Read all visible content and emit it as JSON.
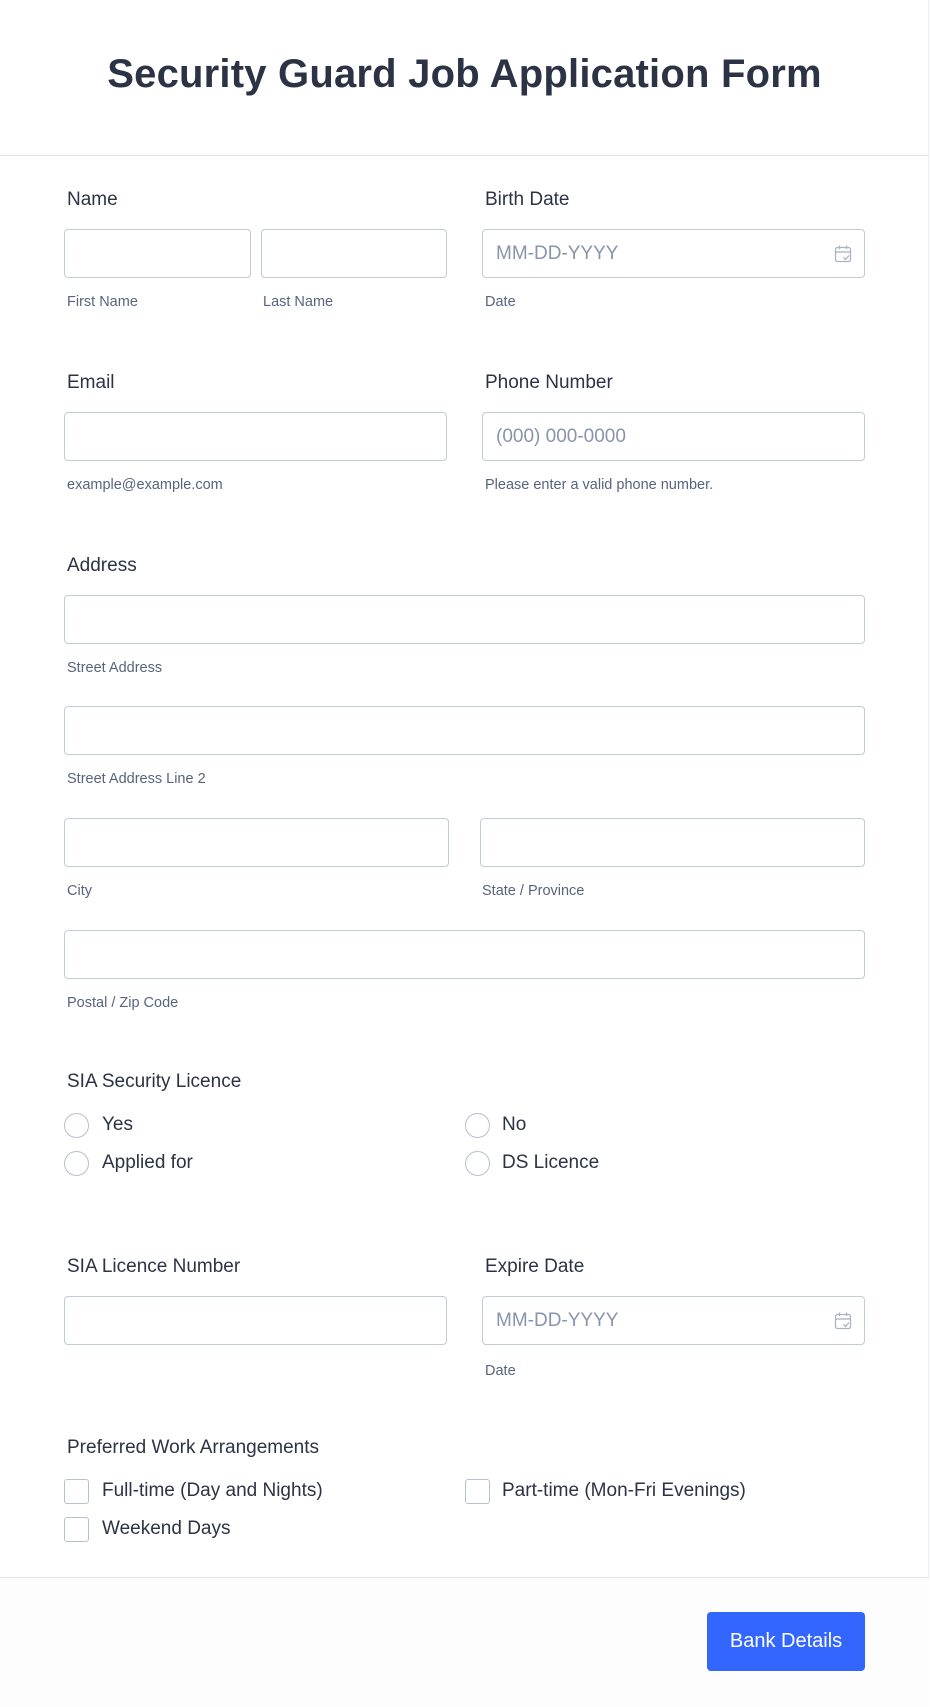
{
  "header": {
    "title": "Security Guard Job Application Form"
  },
  "fields": {
    "name": {
      "label": "Name",
      "first_sublabel": "First Name",
      "last_sublabel": "Last Name",
      "first_value": "",
      "last_value": ""
    },
    "birth_date": {
      "label": "Birth Date",
      "placeholder": "MM-DD-YYYY",
      "sublabel": "Date",
      "icon": "calendar-icon"
    },
    "email": {
      "label": "Email",
      "value": "",
      "sublabel": "example@example.com"
    },
    "phone": {
      "label": "Phone Number",
      "placeholder": "(000) 000-0000",
      "sublabel": "Please enter a valid phone number."
    },
    "address": {
      "label": "Address",
      "street_sublabel": "Street Address",
      "street2_sublabel": "Street Address Line 2",
      "city_sublabel": "City",
      "state_sublabel": "State / Province",
      "postal_sublabel": "Postal / Zip Code"
    },
    "sia_licence": {
      "label": "SIA Security Licence",
      "options": [
        "Yes",
        "No",
        "Applied for",
        "DS Licence"
      ],
      "selected": null
    },
    "sia_number": {
      "label": "SIA Licence Number",
      "value": ""
    },
    "expire_date": {
      "label": "Expire Date",
      "placeholder": "MM-DD-YYYY",
      "sublabel": "Date",
      "icon": "calendar-icon"
    },
    "work_arrangements": {
      "label": "Preferred Work Arrangements",
      "options": [
        "Full-time (Day and Nights)",
        "Part-time (Mon-Fri Evenings)",
        "Weekend Days"
      ],
      "checked": []
    }
  },
  "footer": {
    "next_button": "Bank Details"
  },
  "colors": {
    "accent": "#3366ff",
    "text": "#2c3345",
    "sublabel": "#57647e",
    "border": "#c3cad8"
  }
}
